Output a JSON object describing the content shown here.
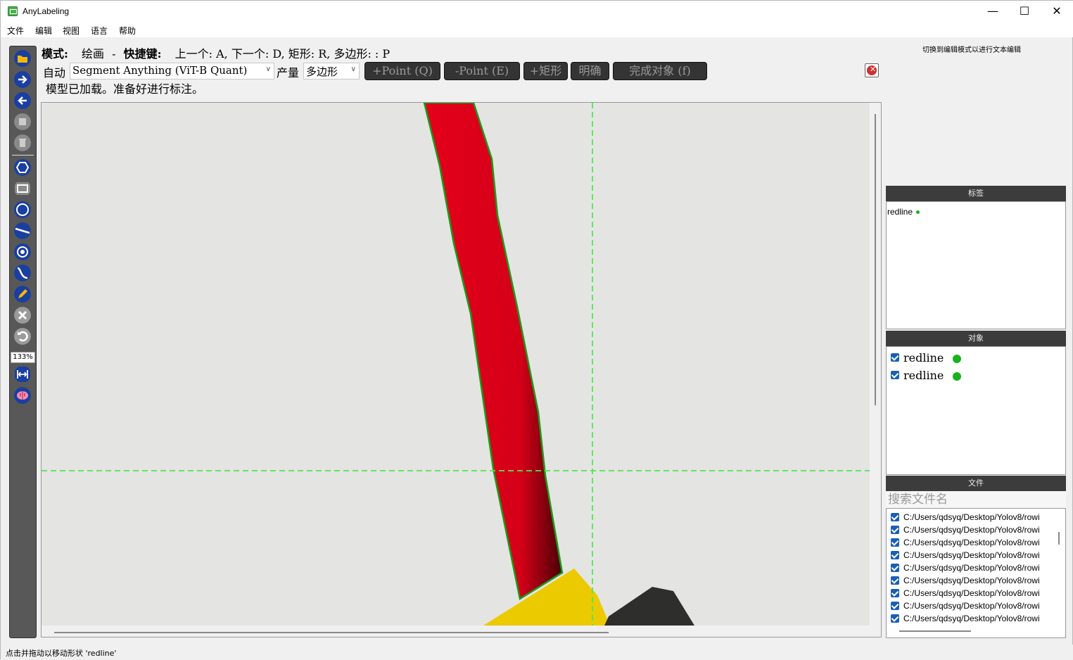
{
  "window": {
    "title": "AnyLabeling",
    "minimize": "—",
    "maximize": "☐",
    "close": "✕"
  },
  "menu": [
    "文件",
    "编辑",
    "视图",
    "语言",
    "帮助"
  ],
  "toolbar": {
    "zoom": "133%"
  },
  "mode": {
    "prefix": "模式:",
    "mode_value": "绘画",
    "dash": "-",
    "shortcut_label": "快捷键:",
    "text": "上一个:  A,  下一个:  D,  矩形:  R,  多边形:  :  P"
  },
  "auto_row": {
    "auto_label": "自动",
    "model_select": "Segment Anything (ViT-B Quant)",
    "output_label": "产量",
    "output_select": "多边形",
    "btn_add_point": "+Point (Q)",
    "btn_remove_point": "-Point (E)",
    "btn_add_rect": "+矩形",
    "btn_clear": "明确",
    "btn_finish": "完成对象 (f)"
  },
  "model_status": "模型已加载。准备好进行标注。",
  "right_hint": "切换到编辑模式以进行文本编辑",
  "labels_panel": {
    "title": "标签",
    "items": [
      {
        "name": "redline",
        "color": "#16b31a"
      }
    ]
  },
  "objects_panel": {
    "title": "对象",
    "items": [
      {
        "name": "redline",
        "color": "#16b31a"
      },
      {
        "name": "redline",
        "color": "#16b31a"
      }
    ]
  },
  "files_panel": {
    "title": "文件",
    "search_placeholder": "搜索文件名",
    "items": [
      "C:/Users/qdsyq/Desktop/Yolov8/rowi",
      "C:/Users/qdsyq/Desktop/Yolov8/rowi",
      "C:/Users/qdsyq/Desktop/Yolov8/rowi",
      "C:/Users/qdsyq/Desktop/Yolov8/rowi",
      "C:/Users/qdsyq/Desktop/Yolov8/rowi",
      "C:/Users/qdsyq/Desktop/Yolov8/rowi",
      "C:/Users/qdsyq/Desktop/Yolov8/rowi",
      "C:/Users/qdsyq/Desktop/Yolov8/rowi",
      "C:/Users/qdsyq/Desktop/Yolov8/rowi"
    ]
  },
  "status_bar": "点击并拖动以移动形状 'redline'",
  "colors": {
    "accent": "#16b31a",
    "shape_fill": "#e0001a",
    "toolbar_bg": "#585858",
    "button_dark": "#343434"
  },
  "icons": [
    "open-folder-icon",
    "next-image-icon",
    "prev-image-icon",
    "save-icon",
    "delete-icon",
    "polygon-icon",
    "rectangle-icon",
    "circle-icon",
    "line-icon",
    "point-icon",
    "linestrip-icon",
    "edit-pencil-icon",
    "close-shape-icon",
    "undo-icon",
    "fit-width-icon",
    "brain-icon"
  ]
}
